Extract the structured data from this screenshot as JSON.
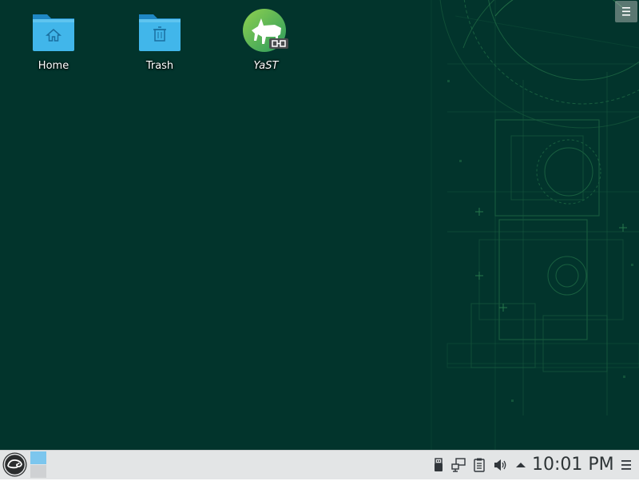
{
  "desktop": {
    "icons": [
      {
        "label": "Home",
        "icon": "folder-home-icon"
      },
      {
        "label": "Trash",
        "icon": "folder-trash-icon"
      },
      {
        "label": "YaST",
        "icon": "yast-icon"
      }
    ],
    "toolbox_icon": "hamburger-icon"
  },
  "panel": {
    "launcher_icon": "opensuse-gecko-icon",
    "pager_icon": "virtual-desktop-pager",
    "tray": [
      {
        "icon": "usb-device-icon"
      },
      {
        "icon": "network-icon"
      },
      {
        "icon": "clipboard-icon"
      },
      {
        "icon": "volume-icon"
      },
      {
        "icon": "expand-up-arrow-icon"
      }
    ],
    "clock": "10:01 PM",
    "menu_icon": "hamburger-icon"
  },
  "colors": {
    "desktop_background": "#02342c",
    "panel_background": "#e3e5e6",
    "folder_blue": "#41b6ea",
    "accent_green": "#73ba25"
  }
}
